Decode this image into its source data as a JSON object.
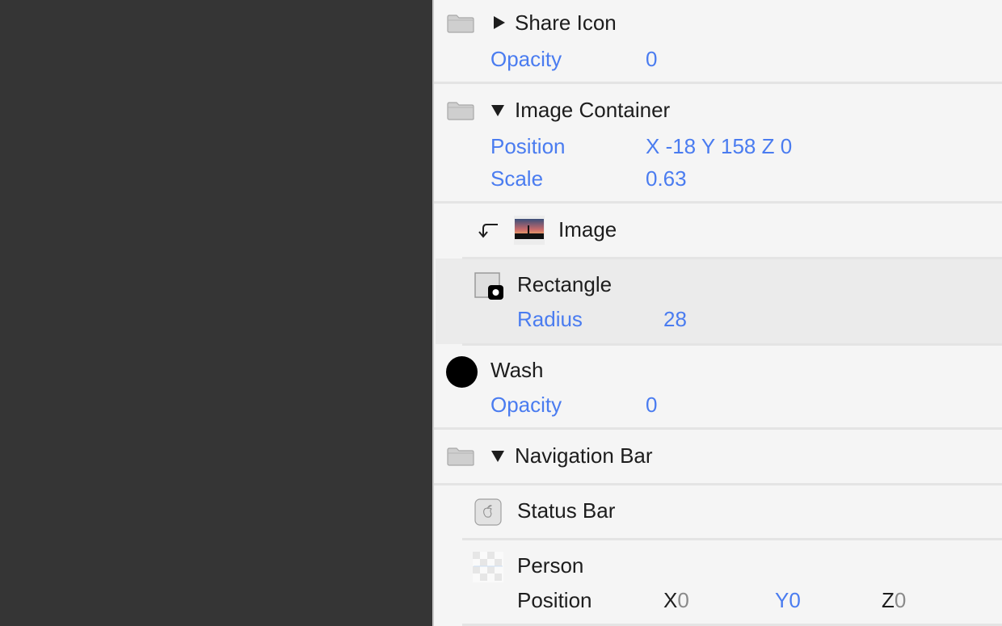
{
  "layers": {
    "share_icon": {
      "name": "Share Icon",
      "expanded": false,
      "props": {
        "opacity_label": "Opacity",
        "opacity_value": "0"
      }
    },
    "image_container": {
      "name": "Image Container",
      "expanded": true,
      "props": {
        "position_label": "Position",
        "position_value": "X -18 Y 158 Z 0",
        "scale_label": "Scale",
        "scale_value": "0.63"
      }
    },
    "image": {
      "name": "Image"
    },
    "rectangle": {
      "name": "Rectangle",
      "selected": true,
      "props": {
        "radius_label": "Radius",
        "radius_value": "28"
      }
    },
    "wash": {
      "name": "Wash",
      "props": {
        "opacity_label": "Opacity",
        "opacity_value": "0"
      }
    },
    "navigation_bar": {
      "name": "Navigation Bar",
      "expanded": true
    },
    "status_bar": {
      "name": "Status Bar"
    },
    "person": {
      "name": "Person",
      "props": {
        "position_label": "Position",
        "x_label": "X",
        "x_value": "0",
        "y_label": "Y0",
        "z_label": "Z",
        "z_value": "0"
      }
    }
  },
  "colors": {
    "accent": "#4a7cf0",
    "panel_bg": "#f5f5f5",
    "canvas_bg": "#353535",
    "selected_bg": "#ebebeb"
  }
}
